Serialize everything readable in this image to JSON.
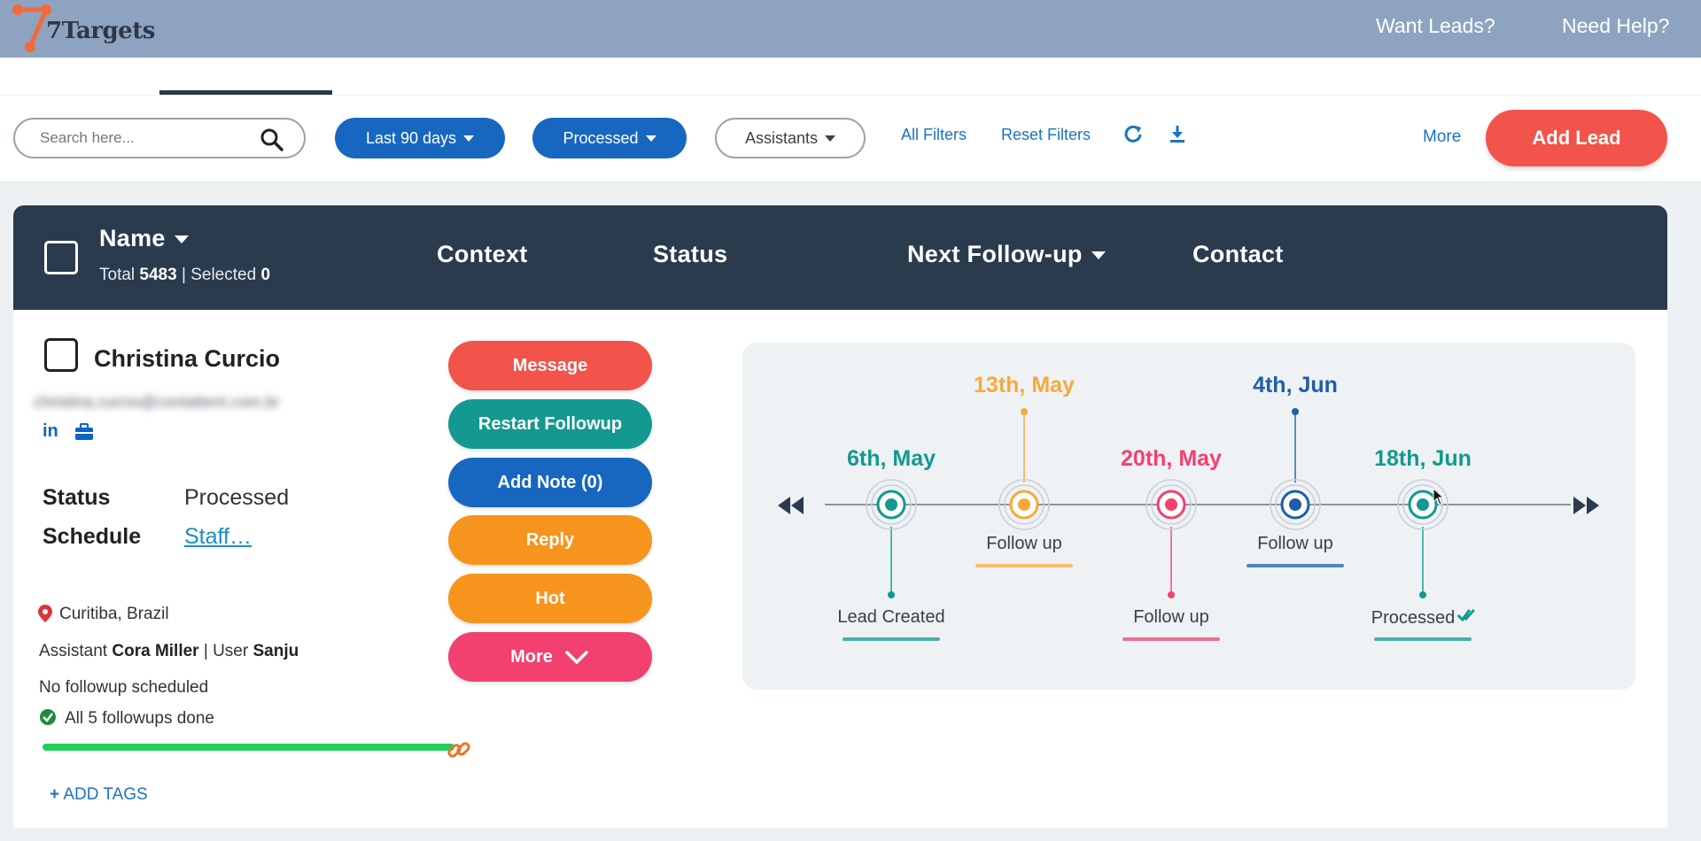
{
  "brand": {
    "name": "7Targets",
    "color": "#f26a3b"
  },
  "topnav": {
    "want_leads": "Want Leads?",
    "need_help": "Need Help?"
  },
  "filters": {
    "search_placeholder": "Search here...",
    "date_range": "Last 90 days",
    "state": "Processed",
    "assistants": "Assistants",
    "all_filters": "All Filters",
    "reset_filters": "Reset Filters",
    "refresh_icon": "refresh-icon",
    "download_icon": "download-icon",
    "more": "More",
    "add_lead": "Add Lead"
  },
  "table": {
    "columns": {
      "name": "Name",
      "context": "Context",
      "status": "Status",
      "next_followup": "Next Follow-up",
      "contact": "Contact"
    },
    "total_label": "Total",
    "total": "5483",
    "selected_label": "Selected",
    "selected": "0"
  },
  "lead": {
    "name": "Christina Curcio",
    "email": "christina.curcio@contattent.com.br",
    "linkedin": "in",
    "status_label": "Status",
    "status": "Processed",
    "schedule_label": "Schedule",
    "schedule": "Staff…",
    "location": "Curitiba, Brazil",
    "assistant_label": "Assistant",
    "assistant": "Cora Miller",
    "user_label": "User",
    "user": "Sanju",
    "followup_note": "No followup scheduled",
    "followups_done": "All 5 followups done",
    "progress": 1.0,
    "add_tags": "ADD TAGS",
    "actions": {
      "message": "Message",
      "restart": "Restart Followup",
      "add_note": "Add Note (0)",
      "reply": "Reply",
      "hot": "Hot",
      "more": "More"
    },
    "action_colors": {
      "message": "#f2534a",
      "restart": "#13998f",
      "add_note": "#1767c1",
      "reply": "#f7941d",
      "hot": "#f7941d",
      "more": "#f2416e"
    }
  },
  "timeline": {
    "events": [
      {
        "date": "6th, May",
        "label": "Lead Created",
        "color": "#13998f"
      },
      {
        "date": "13th, May",
        "label": "Follow up",
        "color": "#f7a93a"
      },
      {
        "date": "20th, May",
        "label": "Follow up",
        "color": "#f2416e"
      },
      {
        "date": "4th, Jun",
        "label": "Follow up",
        "color": "#1f5fa8"
      },
      {
        "date": "18th, Jun",
        "label": "Processed",
        "color": "#13998f"
      }
    ],
    "processed_date_color": "#13998f"
  }
}
